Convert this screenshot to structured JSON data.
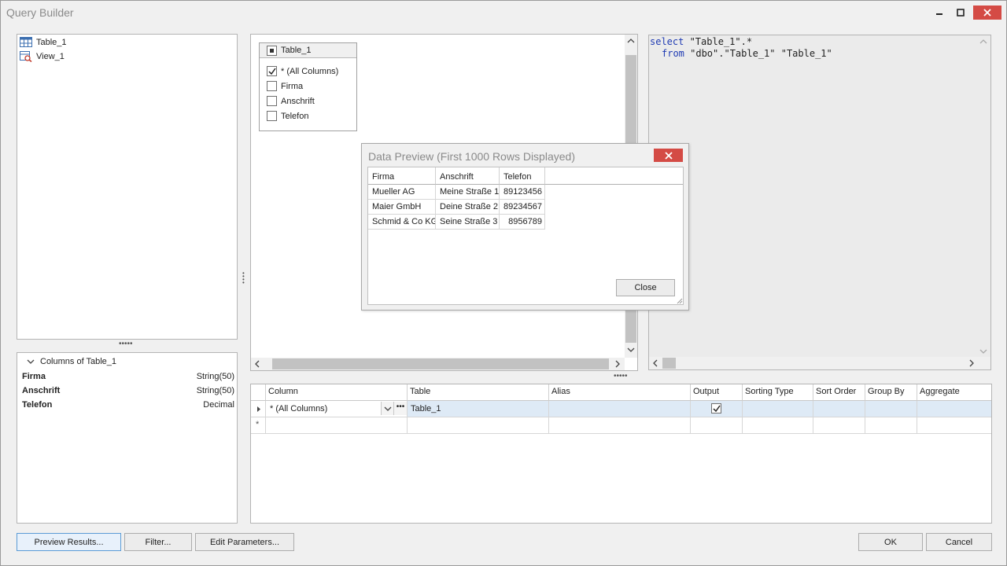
{
  "window": {
    "title": "Query Builder"
  },
  "objects": {
    "items": [
      {
        "label": "Table_1",
        "icon": "table-icon"
      },
      {
        "label": "View_1",
        "icon": "view-icon"
      }
    ]
  },
  "columns_panel": {
    "title": "Columns of Table_1",
    "rows": [
      {
        "name": "Firma",
        "type": "String(50)"
      },
      {
        "name": "Anschrift",
        "type": "String(50)"
      },
      {
        "name": "Telefon",
        "type": "Decimal"
      }
    ]
  },
  "diagram": {
    "table_name": "Table_1",
    "columns": [
      {
        "label": "* (All Columns)",
        "checked": true
      },
      {
        "label": "Firma",
        "checked": false
      },
      {
        "label": "Anschrift",
        "checked": false
      },
      {
        "label": "Telefon",
        "checked": false
      }
    ]
  },
  "sql": {
    "line1_kw": "select",
    "line1_rest": " \"Table_1\".*",
    "line2_kw": "from",
    "line2_rest": " \"dbo\".\"Table_1\" \"Table_1\""
  },
  "grid": {
    "headers": [
      "Column",
      "Table",
      "Alias",
      "Output",
      "Sorting Type",
      "Sort Order",
      "Group By",
      "Aggregate"
    ],
    "row": {
      "column": "* (All Columns)",
      "table": "Table_1",
      "alias": "",
      "output": true
    },
    "new_row_marker": "*"
  },
  "dialog": {
    "title": "Data Preview (First 1000 Rows Displayed)",
    "headers": [
      "Firma",
      "Anschrift",
      "Telefon"
    ],
    "rows": [
      [
        "Mueller AG",
        "Meine Straße 1",
        "89123456"
      ],
      [
        "Maier GmbH",
        "Deine Straße 2",
        "89234567"
      ],
      [
        "Schmid & Co KG",
        "Seine Straße 3",
        "8956789"
      ]
    ],
    "close_label": "Close"
  },
  "buttons": {
    "preview": "Preview Results...",
    "filter": "Filter...",
    "edit_params": "Edit Parameters...",
    "ok": "OK",
    "cancel": "Cancel"
  },
  "colors": {
    "accent_blue": "#1f3bb3",
    "close_red": "#d44b45",
    "selected_row": "#deeaf6"
  }
}
